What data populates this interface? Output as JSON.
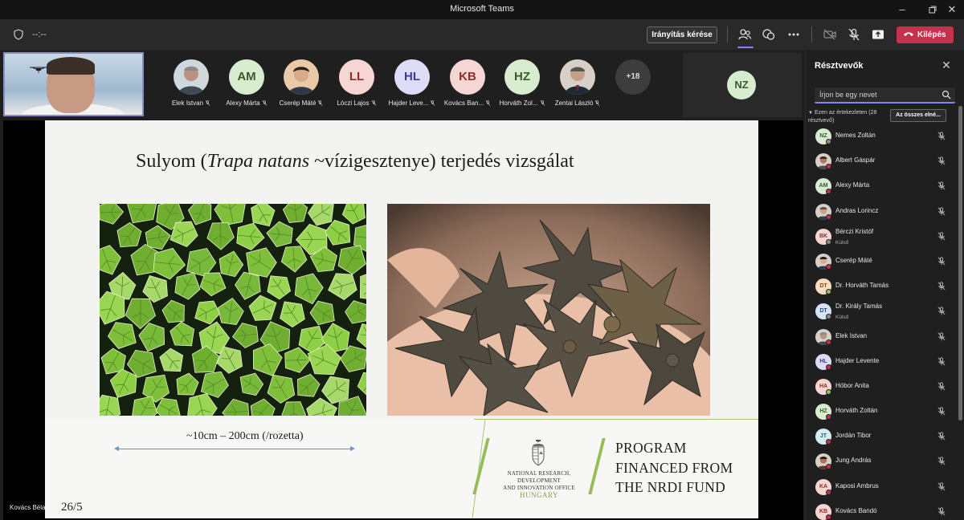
{
  "window": {
    "title": "Microsoft Teams",
    "controls": [
      "minimize",
      "maximize",
      "close"
    ]
  },
  "toolbar": {
    "timer": "--:--",
    "request_control_label": "Irányítás kérése",
    "leave_label": "Kilépés",
    "accent_color": "#7f85f5",
    "leave_color": "#c4314b"
  },
  "strip": {
    "self_icon": "drone-icon",
    "participants": [
      {
        "name": "Elek Istvan",
        "initials": "",
        "photo": true
      },
      {
        "name": "Alexy Márta",
        "initials": "AM",
        "bg": "#d8ecd0",
        "fg": "#3a5a2e"
      },
      {
        "name": "Cserép Máté",
        "initials": "",
        "photo": true
      },
      {
        "name": "Lóczi Lajos",
        "initials": "LL",
        "bg": "#f6d6d3",
        "fg": "#8a2f2a"
      },
      {
        "name": "Hajder Leve...",
        "initials": "HL",
        "bg": "#dcdcf6",
        "fg": "#3b3d8a"
      },
      {
        "name": "Kovács Ban...",
        "initials": "KB",
        "bg": "#f6d6d3",
        "fg": "#8a2f2a"
      },
      {
        "name": "Horváth Zol...",
        "initials": "HZ",
        "bg": "#d8ecd0",
        "fg": "#3a5a2e"
      },
      {
        "name": "Zentai László",
        "initials": "",
        "photo": true
      }
    ],
    "more_count": "+18",
    "extra_tile": {
      "initials": "NZ"
    }
  },
  "slide": {
    "title_pre": "Sulyom (",
    "title_italic": "Trapa natans",
    "title_post": " ~vízigesztenye) terjedés vizsgálat",
    "measure": "~10cm – 200cm (/rozetta)",
    "page": "26/5",
    "nrdi_line1": "NATIONAL RESEARCH, DEVELOPMENT",
    "nrdi_line2": "AND INNOVATION OFFICE",
    "nrdi_country": "HUNGARY",
    "program_l1": "PROGRAM",
    "program_l2": "FINANCED FROM",
    "program_l3": "THE NRDI FUND"
  },
  "presenter": {
    "name": "Kovács Béla"
  },
  "panel": {
    "title": "Résztvevők",
    "search_placeholder": "Írjon be egy nevet",
    "section_label": "Ezen az értekezleten (28 résztvevő)",
    "mute_all_label": "Az összes elné...",
    "participants": [
      {
        "name": "Nemes Zoltán",
        "initials": "NZ",
        "bg": "#d8ecd0",
        "fg": "#3a5a2e",
        "status": "#8a8a8a"
      },
      {
        "name": "Albert Gáspár",
        "initials": "",
        "photo": true,
        "status": "#c4314b"
      },
      {
        "name": "Alexy Márta",
        "initials": "AM",
        "bg": "#d8ecd0",
        "fg": "#3a5a2e",
        "status": "#c4314b"
      },
      {
        "name": "Andras Lorincz",
        "initials": "",
        "photo": true,
        "status": "#c4314b"
      },
      {
        "name": "Bérczi Kristóf",
        "sub": "Külső",
        "initials": "BK",
        "bg": "#f6d6d3",
        "fg": "#8a2f2a",
        "status": "#8a8a8a"
      },
      {
        "name": "Cserép Máté",
        "initials": "",
        "photo": true,
        "status": "#c4314b"
      },
      {
        "name": "Dr. Horváth Tamás",
        "initials": "DT",
        "bg": "#f8dcc4",
        "fg": "#8a4a16",
        "status": "#92c353"
      },
      {
        "name": "Dr. Király Tamás",
        "sub": "Külső",
        "initials": "DT",
        "bg": "#d6e4f6",
        "fg": "#2c4a7a",
        "status": "#8a8a8a"
      },
      {
        "name": "Elek Istvan",
        "initials": "",
        "photo": true,
        "status": "#c4314b"
      },
      {
        "name": "Hajder Levente",
        "initials": "HL",
        "bg": "#dcdcf6",
        "fg": "#3b3d8a",
        "status": "#c4314b"
      },
      {
        "name": "Hóbor Anita",
        "initials": "HA",
        "bg": "#f6d6d3",
        "fg": "#8a2f2a",
        "status": "#92c353"
      },
      {
        "name": "Horváth Zoltán",
        "initials": "HZ",
        "bg": "#d8ecd0",
        "fg": "#3a5a2e",
        "status": "#c4314b"
      },
      {
        "name": "Jordán Tibor",
        "initials": "JT",
        "bg": "#d4eef0",
        "fg": "#22616a",
        "status": "#c4314b"
      },
      {
        "name": "Jung András",
        "initials": "",
        "photo": true,
        "status": "#c4314b"
      },
      {
        "name": "Kaposi Ambrus",
        "initials": "KA",
        "bg": "#f6d6d3",
        "fg": "#8a2f2a",
        "status": "#c4314b"
      },
      {
        "name": "Kovács Bandó",
        "initials": "KB",
        "bg": "#f6d6d3",
        "fg": "#8a2f2a",
        "status": "#c4314b"
      }
    ]
  }
}
